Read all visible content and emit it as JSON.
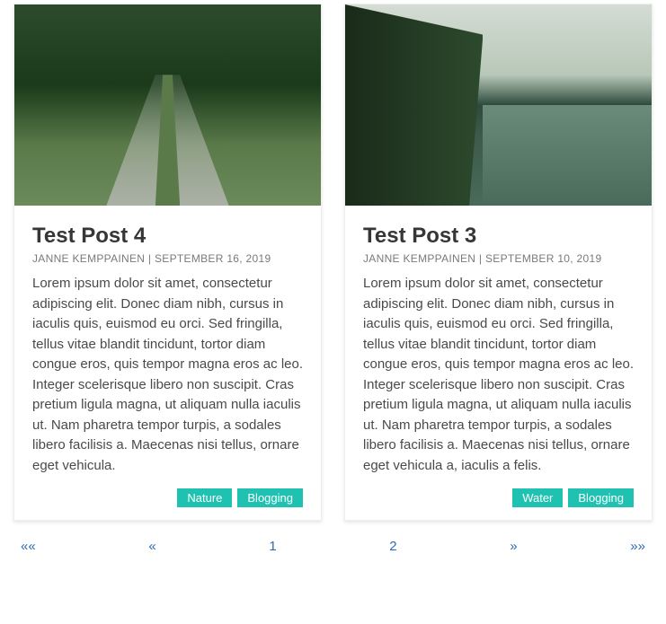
{
  "posts": [
    {
      "image_alt": "forest-path",
      "title": "Test Post 4",
      "author": "JANNE KEMPPAINEN",
      "date": "SEPTEMBER 16, 2019",
      "excerpt": "Lorem ipsum dolor sit amet, consectetur adipiscing elit. Donec diam nibh, cursus in iaculis quis, euismod eu orci. Sed fringilla, tellus vitae blandit tincidunt, tortor diam congue eros, quis tempor magna eros ac leo. Integer scelerisque libero non suscipit. Cras pretium ligula magna, ut aliquam nulla iaculis ut. Nam pharetra tempor turpis, a sodales libero facilisis a. Maecenas nisi tellus, ornare eget vehicula.",
      "tags": [
        "Nature",
        "Blogging"
      ]
    },
    {
      "image_alt": "river-forest",
      "title": "Test Post 3",
      "author": "JANNE KEMPPAINEN",
      "date": "SEPTEMBER 10, 2019",
      "excerpt": "Lorem ipsum dolor sit amet, consectetur adipiscing elit. Donec diam nibh, cursus in iaculis quis, euismod eu orci. Sed fringilla, tellus vitae blandit tincidunt, tortor diam congue eros, quis tempor magna eros ac leo. Integer scelerisque libero non suscipit. Cras pretium ligula magna, ut aliquam nulla iaculis ut. Nam pharetra tempor turpis, a sodales libero facilisis a. Maecenas nisi tellus, ornare eget vehicula a, iaculis a felis.",
      "tags": [
        "Water",
        "Blogging"
      ]
    }
  ],
  "pagination": {
    "first": "««",
    "prev": "«",
    "page1": "1",
    "page2": "2",
    "next": "»",
    "last": "»»"
  }
}
